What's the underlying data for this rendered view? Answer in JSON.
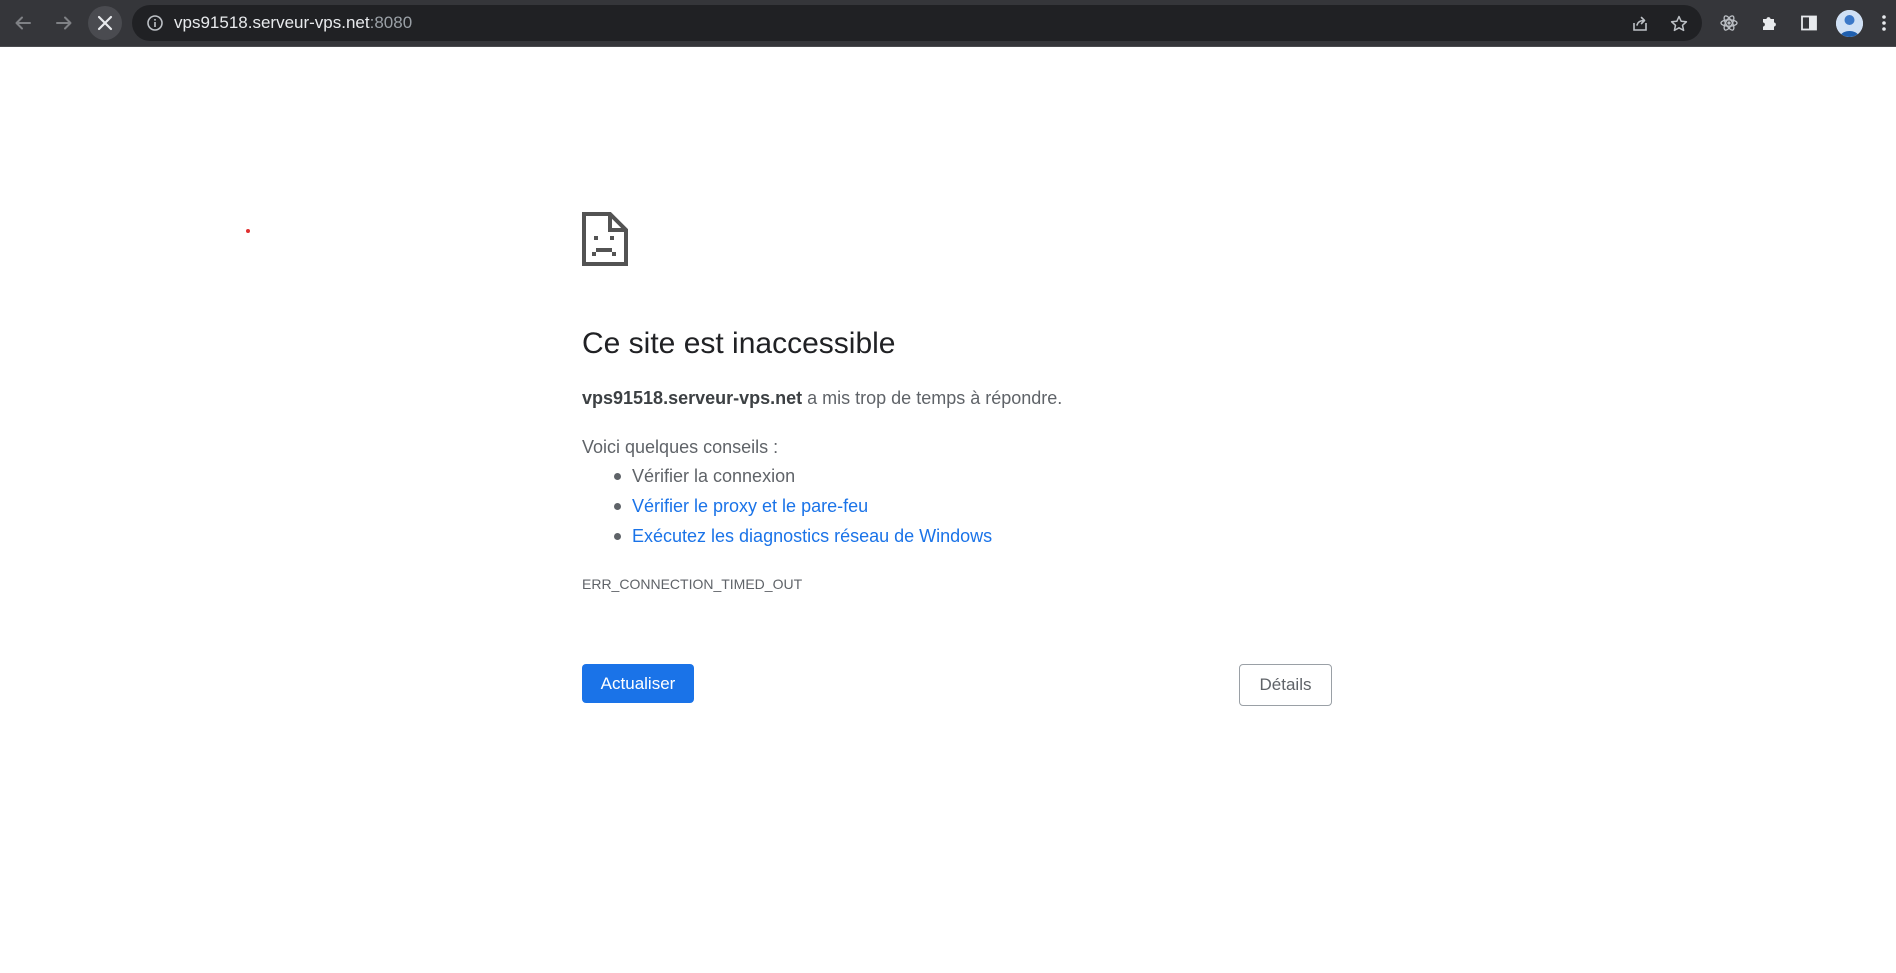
{
  "browser": {
    "url_host": "vps91518.serveur-vps.net",
    "url_port": ":8080",
    "icons": {
      "back": "back-arrow-icon",
      "forward": "forward-arrow-icon",
      "stop": "stop-loading-icon",
      "info": "site-info-icon",
      "share": "share-icon",
      "bookmark": "star-icon",
      "react_devtools": "react-icon",
      "extensions": "puzzle-icon",
      "side_panel": "side-panel-icon",
      "profile": "avatar",
      "menu": "kebab-menu-icon"
    },
    "colors": {
      "toolbar": "#35363a",
      "omnibox": "#202124"
    }
  },
  "error": {
    "icon": "sad-page-icon",
    "title": "Ce site est inaccessible",
    "summary_host": "vps91518.serveur-vps.net",
    "summary_text": " a mis trop de temps à répondre.",
    "suggestions_heading": "Voici quelques conseils :",
    "suggestions": [
      {
        "label": "Vérifier la connexion",
        "link": false
      },
      {
        "label": "Vérifier le proxy et le pare-feu",
        "link": true
      },
      {
        "label": "Exécutez les diagnostics réseau de Windows",
        "link": true
      }
    ],
    "code": "ERR_CONNECTION_TIMED_OUT",
    "reload_label": "Actualiser",
    "details_label": "Détails",
    "colors": {
      "primary": "#1a73e8",
      "link": "#1a73e8",
      "text": "#5f6368"
    }
  }
}
